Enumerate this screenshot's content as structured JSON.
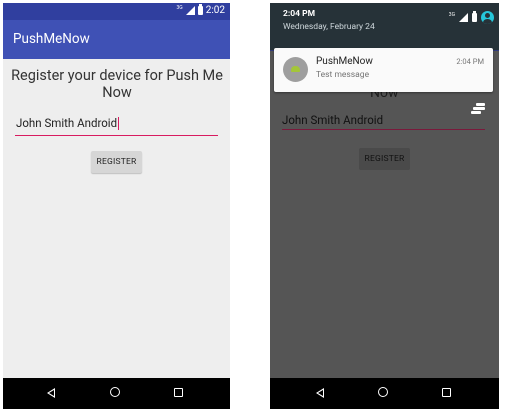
{
  "left_screen": {
    "status_bar": {
      "time": "2:02",
      "network": "3G"
    },
    "app_bar": {
      "title": "PushMeNow"
    },
    "heading": "Register your device for Push Me Now",
    "name_field": {
      "value": "John Smith Android"
    },
    "register_button": {
      "label": "REGISTER"
    }
  },
  "right_screen": {
    "notification_shade": {
      "time": "2:04 PM",
      "date": "Wednesday, February 24",
      "network": "3G"
    },
    "notification": {
      "app_name": "PushMeNow",
      "message": "Test message",
      "time": "2:04 PM"
    },
    "heading_fragment": "Now",
    "name_field": {
      "value": "John Smith Android"
    },
    "register_button": {
      "label": "REGISTER"
    }
  },
  "colors": {
    "status_bar": "#303f9f",
    "app_bar": "#3f51b5",
    "accent": "#d81b60",
    "shade": "#263238",
    "account_icon": "#26c6da",
    "screen_bg": "#eeeeee",
    "dimmed_bg": "#555555"
  },
  "icons": [
    "signal-icon",
    "battery-icon",
    "account-icon",
    "android-robot-icon",
    "drag-handle-icon",
    "nav-back-icon",
    "nav-home-icon",
    "nav-recents-icon"
  ]
}
